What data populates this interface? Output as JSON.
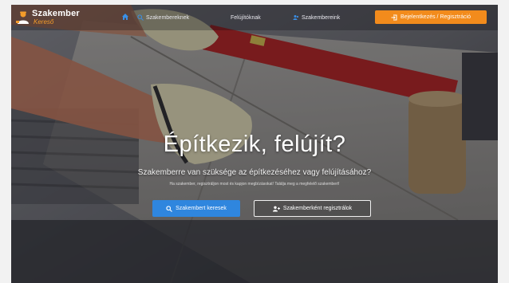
{
  "logo": {
    "line1": "Szakember",
    "line2": "Kereső",
    "icon": "worker-icon",
    "accent": "#f39c2a"
  },
  "nav": {
    "home_icon": "home-icon",
    "items": [
      {
        "label": "Szakembereknek",
        "icon": "search-icon"
      },
      {
        "label": "Felújítóknak",
        "icon": "none"
      },
      {
        "label": "Szakembereink",
        "icon": "users-icon"
      }
    ],
    "cta": {
      "label": "Bejelentkezés / Regisztráció",
      "icon": "login-icon",
      "color": "#f28b1c"
    }
  },
  "hero": {
    "title": "Építkezik, felújít?",
    "subtitle": "Szakemberre van szüksége az építkezéséhez vagy felújításához?",
    "small": "Ha szakember, regisztráljon most és kapjon megbízásokat! Találja meg a megfelelő szakembert!"
  },
  "buttons": {
    "primary": {
      "label": "Szakembert keresek",
      "icon": "search-icon",
      "color": "#2f86de"
    },
    "secondary": {
      "label": "Szakemberként regisztrálok",
      "icon": "user-plus-icon"
    }
  }
}
